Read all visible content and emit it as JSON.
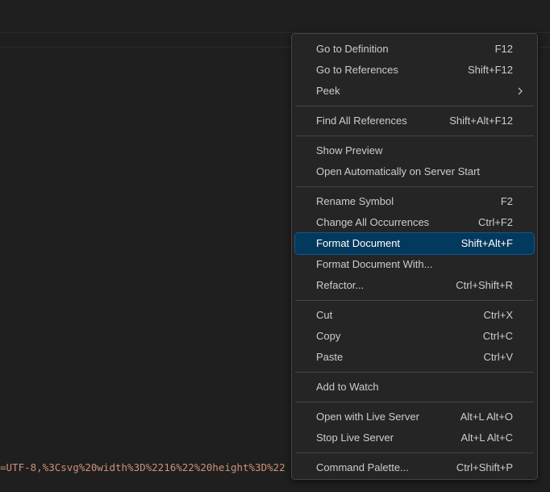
{
  "editor": {
    "code_fragment": "=UTF-8,%3Csvg%20width%3D%2216%22%20height%3D%22"
  },
  "context_menu": {
    "groups": [
      [
        {
          "label": "Go to Definition",
          "shortcut": "F12"
        },
        {
          "label": "Go to References",
          "shortcut": "Shift+F12"
        },
        {
          "label": "Peek",
          "shortcut": "",
          "submenu": true
        }
      ],
      [
        {
          "label": "Find All References",
          "shortcut": "Shift+Alt+F12"
        }
      ],
      [
        {
          "label": "Show Preview",
          "shortcut": ""
        },
        {
          "label": "Open Automatically on Server Start",
          "shortcut": ""
        }
      ],
      [
        {
          "label": "Rename Symbol",
          "shortcut": "F2"
        },
        {
          "label": "Change All Occurrences",
          "shortcut": "Ctrl+F2"
        },
        {
          "label": "Format Document",
          "shortcut": "Shift+Alt+F",
          "selected": true
        },
        {
          "label": "Format Document With...",
          "shortcut": ""
        },
        {
          "label": "Refactor...",
          "shortcut": "Ctrl+Shift+R"
        }
      ],
      [
        {
          "label": "Cut",
          "shortcut": "Ctrl+X"
        },
        {
          "label": "Copy",
          "shortcut": "Ctrl+C"
        },
        {
          "label": "Paste",
          "shortcut": "Ctrl+V"
        }
      ],
      [
        {
          "label": "Add to Watch",
          "shortcut": ""
        }
      ],
      [
        {
          "label": "Open with Live Server",
          "shortcut": "Alt+L Alt+O"
        },
        {
          "label": "Stop Live Server",
          "shortcut": "Alt+L Alt+C"
        }
      ],
      [
        {
          "label": "Command Palette...",
          "shortcut": "Ctrl+Shift+P"
        }
      ]
    ]
  }
}
